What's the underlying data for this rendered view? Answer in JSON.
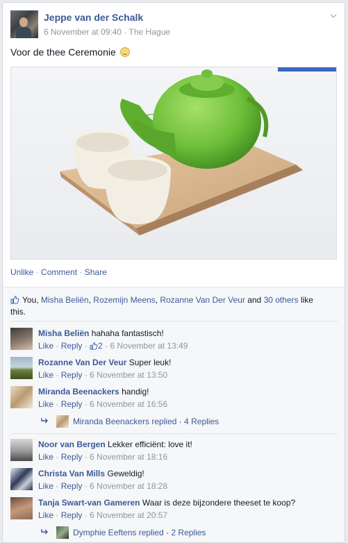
{
  "post": {
    "author": "Jeppe van der Schalk",
    "timestamp": "6 November at 09:40",
    "location": "The Hague",
    "text": "Voor de thee Ceremonie"
  },
  "actions": {
    "unlike": "Unlike",
    "comment": "Comment",
    "share": "Share"
  },
  "likes": {
    "prefix": "You, ",
    "names": [
      "Misha Beliën",
      "Rozemijn Meens",
      "Rozanne Van Der Veur"
    ],
    "and": " and ",
    "others_link": "30 others",
    "suffix": " like this."
  },
  "comments": [
    {
      "name": "Misha Beliën",
      "text": "hahaha fantastisch!",
      "like": "Like",
      "reply": "Reply",
      "likes_count": "2",
      "time": "6 November at 13:49"
    },
    {
      "name": "Rozanne Van Der Veur",
      "text": "Super leuk!",
      "like": "Like",
      "reply": "Reply",
      "time": "6 November at 13:50"
    },
    {
      "name": "Miranda Beenackers",
      "text": "handig!",
      "like": "Like",
      "reply": "Reply",
      "time": "6 November at 16:56",
      "replies": {
        "who": "Miranda Beenackers replied",
        "count": "4 Replies"
      }
    },
    {
      "name": "Noor van Bergen",
      "text": "Lekker efficiënt: love it!",
      "like": "Like",
      "reply": "Reply",
      "time": "6 November at 18:16"
    },
    {
      "name": "Christa Van Mills",
      "text": "Geweldig!",
      "like": "Like",
      "reply": "Reply",
      "time": "6 November at 18:28"
    },
    {
      "name": "Tanja Swart-van Gameren",
      "text": "Waar is deze bijzondere theeset te koop?",
      "like": "Like",
      "reply": "Reply",
      "time": "6 November at 20:57",
      "replies": {
        "who": "Dymphie Eeftens replied",
        "count": "2 Replies"
      }
    }
  ],
  "colors": {
    "link": "#3b5998",
    "meta": "#90949c",
    "teapot": "#6fbf3a",
    "tray": "#d9b48a"
  },
  "icons": [
    "chevron-down-icon",
    "smile-emoji-icon",
    "thumbs-up-icon",
    "reply-arrow-icon"
  ]
}
